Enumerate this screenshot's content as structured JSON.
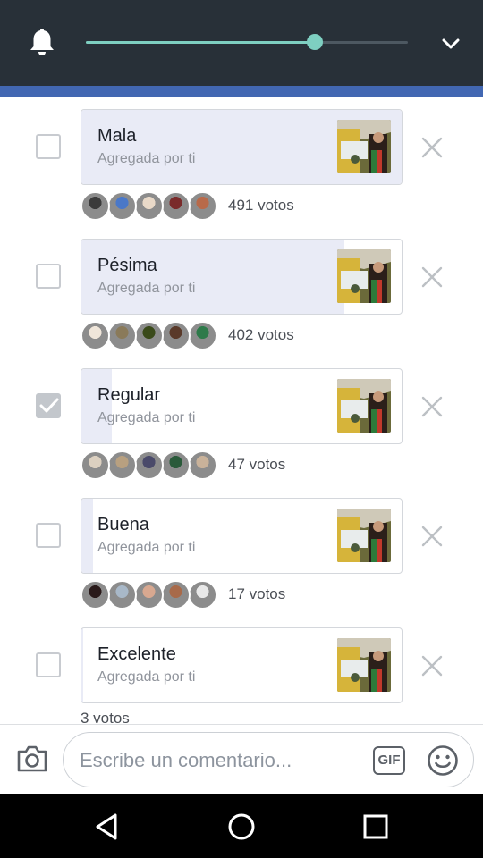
{
  "header": {
    "slider_level_percent": 71
  },
  "poll": {
    "options": [
      {
        "label": "Mala",
        "sub": "Agregada por ti",
        "votes": "491 votos",
        "checked": false,
        "bar_fraction": 1.0
      },
      {
        "label": "Pésima",
        "sub": "Agregada por ti",
        "votes": "402 votos",
        "checked": false,
        "bar_fraction": 0.82
      },
      {
        "label": "Regular",
        "sub": "Agregada por ti",
        "votes": "47 votos",
        "checked": true,
        "bar_fraction": 0.096
      },
      {
        "label": "Buena",
        "sub": "Agregada por ti",
        "votes": "17 votos",
        "checked": false,
        "bar_fraction": 0.035
      },
      {
        "label": "Excelente",
        "sub": "Agregada por ti",
        "votes": "3 votos",
        "checked": false,
        "bar_fraction": 0.006
      }
    ]
  },
  "composer": {
    "placeholder": "Escribe un comentario...",
    "gif_label": "GIF"
  },
  "colors": {
    "topbar": "#283038",
    "accent_blue": "#4267b2",
    "slider": "#7ecfc1",
    "poll_fill": "#e9ebf6"
  },
  "icons": [
    "bell-icon",
    "chevron-down-icon",
    "checkbox-icon",
    "close-icon",
    "camera-icon",
    "gif-icon",
    "smiley-icon",
    "nav-back-icon",
    "nav-home-icon",
    "nav-recents-icon"
  ]
}
